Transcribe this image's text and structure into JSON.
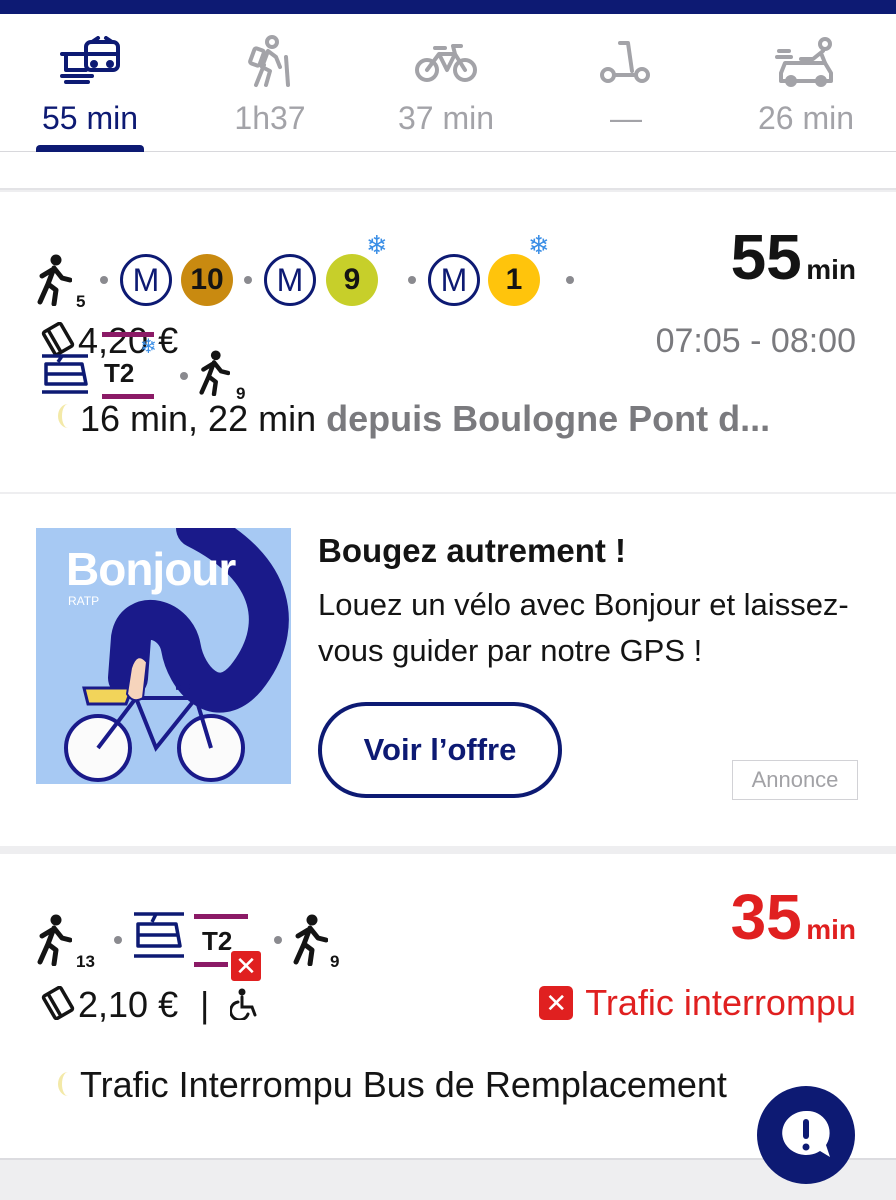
{
  "tabs": [
    {
      "icon": "transit-icon",
      "label": "55 min",
      "active": true
    },
    {
      "icon": "hiker-icon",
      "label": "1h37",
      "active": false
    },
    {
      "icon": "bike-icon",
      "label": "37 min",
      "active": false
    },
    {
      "icon": "scooter-icon",
      "label": "—",
      "active": false
    },
    {
      "icon": "taxi-icon",
      "label": "26 min",
      "active": false
    }
  ],
  "route1": {
    "walk_start": "5",
    "lines": [
      {
        "mode": "M",
        "line": "10",
        "color": "#c98a10",
        "text_color": "#141414"
      },
      {
        "mode": "M",
        "line": "9",
        "color": "#c7cf2a",
        "text_color": "#141414",
        "air_conditioned": true
      },
      {
        "mode": "M",
        "line": "1",
        "color": "#ffc40c",
        "text_color": "#141414",
        "air_conditioned": true
      }
    ],
    "tram_line": "T2",
    "walk_end": "9",
    "duration": "55",
    "unit": "min",
    "price": "4,20 €",
    "times": "07:05 - 08:00",
    "next": "16 min, 22 min",
    "from": "depuis Boulogne Pont d..."
  },
  "ad": {
    "brand": "Bonjour",
    "brand_sub": "RATP",
    "title": "Bougez autrement !",
    "body": "Louez un vélo avec Bonjour et laissez-vous guider par notre GPS !",
    "cta": "Voir l’offre",
    "tag": "Annonce"
  },
  "route2": {
    "walk_start": "13",
    "tram_line": "T2",
    "walk_end": "9",
    "duration": "35",
    "unit": "min",
    "price": "2,10 €",
    "divider": "|",
    "status": "Trafic interrompu",
    "message": "Trafic Interrompu Bus de Remplacement"
  },
  "colors": {
    "navy": "#0d1a73",
    "alert": "#e02020",
    "tram": "#8b1a66",
    "muted": "#a3a3a8"
  }
}
